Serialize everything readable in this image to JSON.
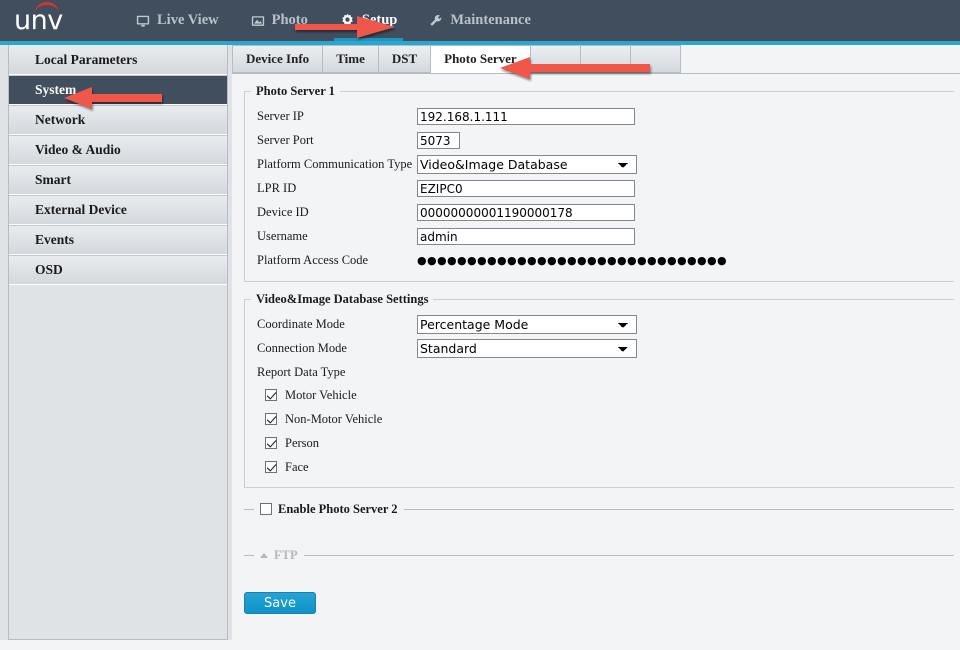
{
  "header": {
    "logo_text": "unv",
    "nav": [
      {
        "label": "Live View",
        "icon": "monitor-icon",
        "active": false
      },
      {
        "label": "Photo",
        "icon": "photo-icon",
        "active": false
      },
      {
        "label": "Setup",
        "icon": "gear-icon",
        "active": true
      },
      {
        "label": "Maintenance",
        "icon": "wrench-icon",
        "active": false
      }
    ]
  },
  "sidebar": {
    "items": [
      {
        "label": "Local Parameters",
        "selected": false
      },
      {
        "label": "System",
        "selected": true
      },
      {
        "label": "Network",
        "selected": false
      },
      {
        "label": "Video & Audio",
        "selected": false
      },
      {
        "label": "Smart",
        "selected": false
      },
      {
        "label": "External Device",
        "selected": false
      },
      {
        "label": "Events",
        "selected": false
      },
      {
        "label": "OSD",
        "selected": false
      }
    ]
  },
  "tabs": [
    {
      "label": "Device Info",
      "active": false
    },
    {
      "label": "Time",
      "active": false
    },
    {
      "label": "DST",
      "active": false
    },
    {
      "label": "Photo Server",
      "active": true
    },
    {
      "label": "",
      "active": false
    },
    {
      "label": "",
      "active": false
    },
    {
      "label": "",
      "active": false
    }
  ],
  "photo_server_1": {
    "legend": "Photo Server 1",
    "fields": {
      "server_ip_label": "Server IP",
      "server_ip_value": "192.168.1.111",
      "server_port_label": "Server Port",
      "server_port_value": "5073",
      "platform_comm_label": "Platform Communication Type",
      "platform_comm_value": "Video&Image Database",
      "lpr_id_label": "LPR ID",
      "lpr_id_value": "EZIPC0",
      "device_id_label": "Device ID",
      "device_id_value": "00000000001190000178",
      "username_label": "Username",
      "username_value": "admin",
      "access_code_label": "Platform Access Code",
      "access_code_masked": "●●●●●●●●●●●●●●●●●●●●●●●●●●●●●●●"
    }
  },
  "database_settings": {
    "legend": "Video&Image Database Settings",
    "coordinate_mode_label": "Coordinate Mode",
    "coordinate_mode_value": "Percentage Mode",
    "connection_mode_label": "Connection Mode",
    "connection_mode_value": "Standard",
    "report_data_type_label": "Report Data Type",
    "report_types": [
      {
        "label": "Motor Vehicle",
        "checked": true
      },
      {
        "label": "Non-Motor Vehicle",
        "checked": true
      },
      {
        "label": "Person",
        "checked": true
      },
      {
        "label": "Face",
        "checked": true
      }
    ]
  },
  "photo_server_2": {
    "label": "Enable Photo Server 2",
    "checked": false
  },
  "ftp": {
    "label": "FTP",
    "collapsed": true,
    "disabled": true
  },
  "save_button": {
    "label": "Save"
  },
  "colors": {
    "header_bg": "#414e5e",
    "accent_cyan": "#29a8cf",
    "logo_red": "#d9342b",
    "save_blue": "#1b9dd0",
    "annotation_red": "#f0574a"
  }
}
